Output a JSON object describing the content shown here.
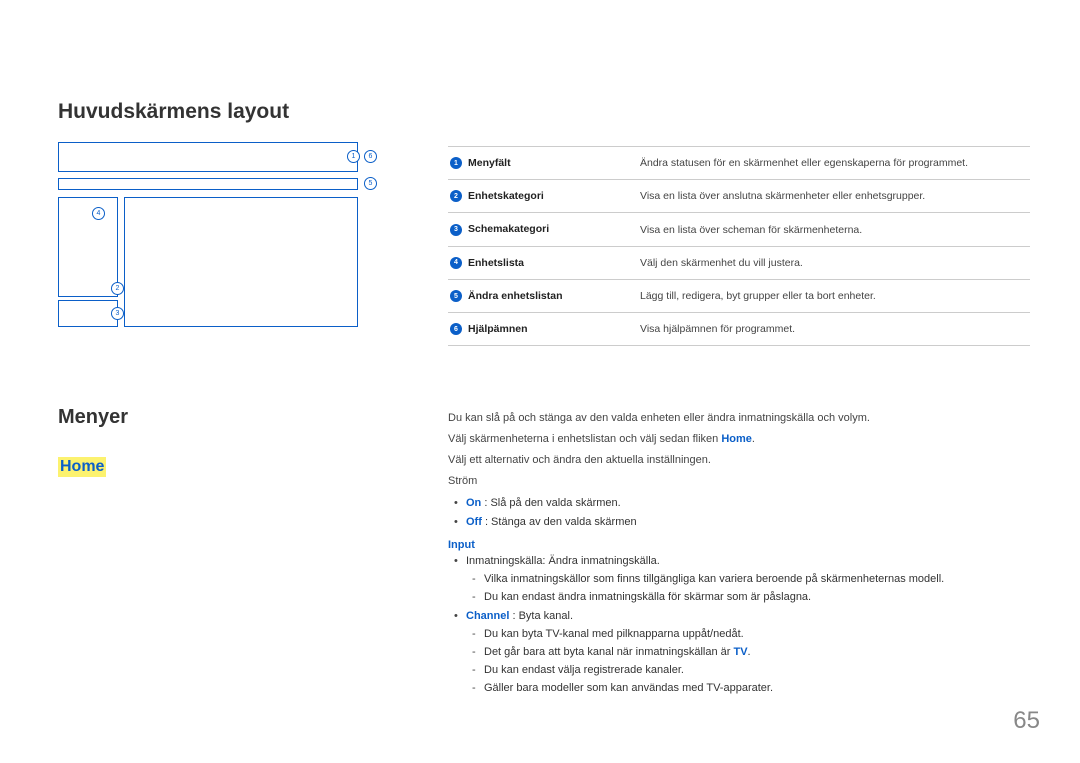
{
  "heading_layout": "Huvudskärmens layout",
  "heading_menyer": "Menyer",
  "heading_home": "Home",
  "diagram_labels": {
    "b1": "1",
    "b2": "2",
    "b3": "3",
    "b4": "4",
    "b5": "5",
    "b6": "6"
  },
  "table": [
    {
      "num": "1",
      "term": "Menyfält",
      "desc": "Ändra statusen för en skärmenhet eller egenskaperna för programmet."
    },
    {
      "num": "2",
      "term": "Enhetskategori",
      "desc": "Visa en lista över anslutna skärmenheter eller enhetsgrupper."
    },
    {
      "num": "3",
      "term": "Schemakategori",
      "desc": "Visa en lista över scheman för skärmenheterna."
    },
    {
      "num": "4",
      "term": "Enhetslista",
      "desc": "Välj den skärmenhet du vill justera."
    },
    {
      "num": "5",
      "term": "Ändra enhetslistan",
      "desc": "Lägg till, redigera, byt grupper eller ta bort enheter."
    },
    {
      "num": "6",
      "term": "Hjälpämnen",
      "desc": "Visa hjälpämnen för programmet."
    }
  ],
  "menyer": {
    "p1": "Du kan slå på och stänga av den valda enheten eller ändra inmatningskälla och volym.",
    "p2_a": "Välj skärmenheterna i enhetslistan och välj sedan fliken ",
    "p2_b_home": "Home",
    "p2_c": ".",
    "p3": "Välj ett alternativ och ändra den aktuella inställningen.",
    "strom_label": "Ström",
    "on_label": "On",
    "on_text": " : Slå på den valda skärmen.",
    "off_label": "Off",
    "off_text": " : Stänga av den valda skärmen",
    "input_label": "Input",
    "inmat1": "Inmatningskälla: Ändra inmatningskälla.",
    "inmat1_sub1": "Vilka inmatningskällor som finns tillgängliga kan variera beroende på skärmenheternas modell.",
    "inmat1_sub2": "Du kan endast ändra inmatningskälla för skärmar som är påslagna.",
    "channel_label": "Channel",
    "channel_text": " : Byta kanal.",
    "ch_sub1": "Du kan byta TV-kanal med pilknapparna uppåt/nedåt.",
    "ch_sub2_a": "Det går bara att byta kanal när inmatningskällan är ",
    "ch_sub2_tv": "TV",
    "ch_sub2_c": ".",
    "ch_sub3": "Du kan endast välja registrerade kanaler.",
    "ch_sub4": "Gäller bara modeller som kan användas med TV-apparater."
  },
  "page_number": "65"
}
